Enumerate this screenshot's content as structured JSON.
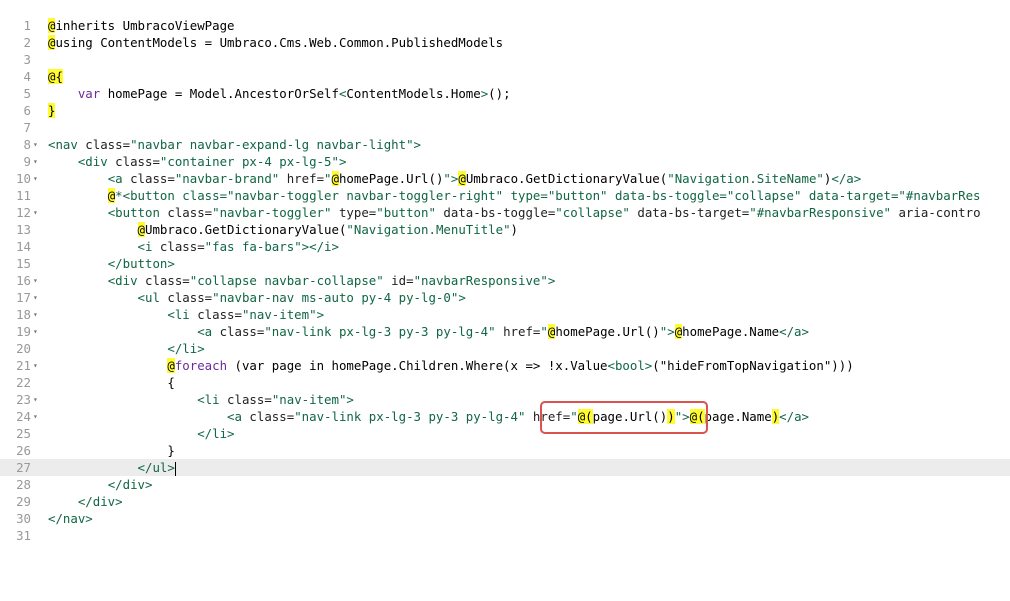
{
  "editor": {
    "lines": [
      {
        "n": "1",
        "fold": false,
        "tokens": [
          [
            "@",
            "hl"
          ],
          [
            "inherits UmbracoViewPage",
            "txt"
          ]
        ]
      },
      {
        "n": "2",
        "fold": false,
        "tokens": [
          [
            "@",
            "hl"
          ],
          [
            "using ContentModels = Umbraco.Cms.Web.Common.PublishedModels",
            "txt"
          ]
        ]
      },
      {
        "n": "3",
        "fold": false,
        "tokens": []
      },
      {
        "n": "4",
        "fold": false,
        "tokens": [
          [
            "@{",
            "hl"
          ]
        ]
      },
      {
        "n": "5",
        "fold": false,
        "tokens": [
          [
            "    ",
            "txt"
          ],
          [
            "var",
            "kw"
          ],
          [
            " homePage = Model.AncestorOrSelf",
            "txt"
          ],
          [
            "<",
            "tag"
          ],
          [
            "ContentModels.Home",
            "txt"
          ],
          [
            ">",
            "tag"
          ],
          [
            "();",
            "txt"
          ]
        ]
      },
      {
        "n": "6",
        "fold": false,
        "tokens": [
          [
            "}",
            "hl"
          ]
        ]
      },
      {
        "n": "7",
        "fold": false,
        "tokens": []
      },
      {
        "n": "8",
        "fold": true,
        "tokens": [
          [
            "<nav",
            "tag"
          ],
          [
            " class=",
            "att"
          ],
          [
            "\"navbar navbar-expand-lg navbar-light\"",
            "str"
          ],
          [
            ">",
            "tag"
          ]
        ]
      },
      {
        "n": "9",
        "fold": true,
        "tokens": [
          [
            "    ",
            "txt"
          ],
          [
            "<div",
            "tag"
          ],
          [
            " class=",
            "att"
          ],
          [
            "\"container px-4 px-lg-5\"",
            "str"
          ],
          [
            ">",
            "tag"
          ]
        ]
      },
      {
        "n": "10",
        "fold": true,
        "tokens": [
          [
            "        ",
            "txt"
          ],
          [
            "<a",
            "tag"
          ],
          [
            " class=",
            "att"
          ],
          [
            "\"navbar-brand\"",
            "str"
          ],
          [
            " href=",
            "att"
          ],
          [
            "\"",
            "str"
          ],
          [
            "@",
            "hl"
          ],
          [
            "homePage.Url()",
            "txt"
          ],
          [
            "\"",
            "str"
          ],
          [
            ">",
            "tag"
          ],
          [
            "@",
            "hl"
          ],
          [
            "Umbraco.GetDictionaryValue(",
            "txt"
          ],
          [
            "\"Navigation.SiteName\"",
            "str"
          ],
          [
            ")",
            "txt"
          ],
          [
            "</a>",
            "tag"
          ]
        ]
      },
      {
        "n": "11",
        "fold": false,
        "tokens": [
          [
            "        ",
            "txt"
          ],
          [
            "@",
            "hl"
          ],
          [
            "*<button class=\"navbar-toggler navbar-toggler-right\" type=\"button\" data-bs-toggle=\"collapse\" data-target=\"#navbarRes",
            "tag"
          ]
        ]
      },
      {
        "n": "12",
        "fold": true,
        "tokens": [
          [
            "        ",
            "txt"
          ],
          [
            "<button",
            "tag"
          ],
          [
            " class=",
            "att"
          ],
          [
            "\"navbar-toggler\"",
            "str"
          ],
          [
            " type=",
            "att"
          ],
          [
            "\"button\"",
            "str"
          ],
          [
            " data-bs-toggle=",
            "att"
          ],
          [
            "\"collapse\"",
            "str"
          ],
          [
            " data-bs-target=",
            "att"
          ],
          [
            "\"#navbarResponsive\"",
            "str"
          ],
          [
            " aria-contro",
            "att"
          ]
        ]
      },
      {
        "n": "13",
        "fold": false,
        "tokens": [
          [
            "            ",
            "txt"
          ],
          [
            "@",
            "hl"
          ],
          [
            "Umbraco.GetDictionaryValue(",
            "txt"
          ],
          [
            "\"Navigation.MenuTitle\"",
            "str"
          ],
          [
            ")",
            "txt"
          ]
        ]
      },
      {
        "n": "14",
        "fold": false,
        "tokens": [
          [
            "            ",
            "txt"
          ],
          [
            "<i",
            "tag"
          ],
          [
            " class=",
            "att"
          ],
          [
            "\"fas fa-bars\"",
            "str"
          ],
          [
            ">",
            "tag"
          ],
          [
            "</i>",
            "tag"
          ]
        ]
      },
      {
        "n": "15",
        "fold": false,
        "tokens": [
          [
            "        ",
            "txt"
          ],
          [
            "</button>",
            "tag"
          ]
        ]
      },
      {
        "n": "16",
        "fold": true,
        "tokens": [
          [
            "        ",
            "txt"
          ],
          [
            "<div",
            "tag"
          ],
          [
            " class=",
            "att"
          ],
          [
            "\"collapse navbar-collapse\"",
            "str"
          ],
          [
            " id=",
            "att"
          ],
          [
            "\"navbarResponsive\"",
            "str"
          ],
          [
            ">",
            "tag"
          ]
        ]
      },
      {
        "n": "17",
        "fold": true,
        "tokens": [
          [
            "            ",
            "txt"
          ],
          [
            "<ul",
            "tag"
          ],
          [
            " class=",
            "att"
          ],
          [
            "\"navbar-nav ms-auto py-4 py-lg-0\"",
            "str"
          ],
          [
            ">",
            "tag"
          ]
        ]
      },
      {
        "n": "18",
        "fold": true,
        "tokens": [
          [
            "                ",
            "txt"
          ],
          [
            "<li",
            "tag"
          ],
          [
            " class=",
            "att"
          ],
          [
            "\"nav-item\"",
            "str"
          ],
          [
            ">",
            "tag"
          ]
        ]
      },
      {
        "n": "19",
        "fold": true,
        "tokens": [
          [
            "                    ",
            "txt"
          ],
          [
            "<a",
            "tag"
          ],
          [
            " class=",
            "att"
          ],
          [
            "\"nav-link px-lg-3 py-3 py-lg-4\"",
            "str"
          ],
          [
            " href=",
            "att"
          ],
          [
            "\"",
            "str"
          ],
          [
            "@",
            "hl"
          ],
          [
            "homePage.Url()",
            "txt"
          ],
          [
            "\"",
            "str"
          ],
          [
            ">",
            "tag"
          ],
          [
            "@",
            "hl"
          ],
          [
            "homePage.Name",
            "txt"
          ],
          [
            "</a>",
            "tag"
          ]
        ]
      },
      {
        "n": "20",
        "fold": false,
        "tokens": [
          [
            "                ",
            "txt"
          ],
          [
            "</li>",
            "tag"
          ]
        ]
      },
      {
        "n": "21",
        "fold": true,
        "tokens": [
          [
            "                ",
            "txt"
          ],
          [
            "@",
            "hl"
          ],
          [
            "foreach",
            "kw"
          ],
          [
            " (var page in homePage.Children.Where(x => !x.Value",
            "txt"
          ],
          [
            "<bool>",
            "tag"
          ],
          [
            "(\"hideFromTopNavigation\")))",
            "txt"
          ]
        ]
      },
      {
        "n": "22",
        "fold": false,
        "tokens": [
          [
            "                {",
            "txt"
          ]
        ]
      },
      {
        "n": "23",
        "fold": true,
        "tokens": [
          [
            "                    ",
            "txt"
          ],
          [
            "<li",
            "tag"
          ],
          [
            " class=",
            "att"
          ],
          [
            "\"nav-item\"",
            "str"
          ],
          [
            ">",
            "tag"
          ]
        ]
      },
      {
        "n": "24",
        "fold": true,
        "tokens": [
          [
            "                        ",
            "txt"
          ],
          [
            "<a",
            "tag"
          ],
          [
            " class=",
            "att"
          ],
          [
            "\"nav-link px-lg-3 py-3 py-lg-4\"",
            "str"
          ],
          [
            " href=",
            "att"
          ],
          [
            "\"",
            "str"
          ],
          [
            "@(",
            "hl"
          ],
          [
            "page.Url()",
            "txt"
          ],
          [
            ")",
            "hl"
          ],
          [
            "\"",
            "str"
          ],
          [
            ">",
            "tag"
          ],
          [
            "@(",
            "hl"
          ],
          [
            "page.Name",
            "txt"
          ],
          [
            ")",
            "hl"
          ],
          [
            "</a>",
            "tag"
          ]
        ]
      },
      {
        "n": "25",
        "fold": false,
        "tokens": [
          [
            "                    ",
            "txt"
          ],
          [
            "</li>",
            "tag"
          ]
        ]
      },
      {
        "n": "26",
        "fold": false,
        "tokens": [
          [
            "                }",
            "txt"
          ]
        ]
      },
      {
        "n": "27",
        "fold": false,
        "active": true,
        "tokens": [
          [
            "            ",
            "txt"
          ],
          [
            "</ul>",
            "tag"
          ]
        ]
      },
      {
        "n": "28",
        "fold": false,
        "tokens": [
          [
            "        ",
            "txt"
          ],
          [
            "</div>",
            "tag"
          ]
        ]
      },
      {
        "n": "29",
        "fold": false,
        "tokens": [
          [
            "    ",
            "txt"
          ],
          [
            "</div>",
            "tag"
          ]
        ]
      },
      {
        "n": "30",
        "fold": false,
        "tokens": [
          [
            "</nav>",
            "tag"
          ]
        ]
      },
      {
        "n": "31",
        "fold": false,
        "tokens": []
      }
    ]
  },
  "colors": {
    "highlight": "#fffb2e",
    "callout_border": "#d9534f",
    "tag": "#116644",
    "keyword": "#6c2b9a",
    "line_number": "#999999"
  }
}
